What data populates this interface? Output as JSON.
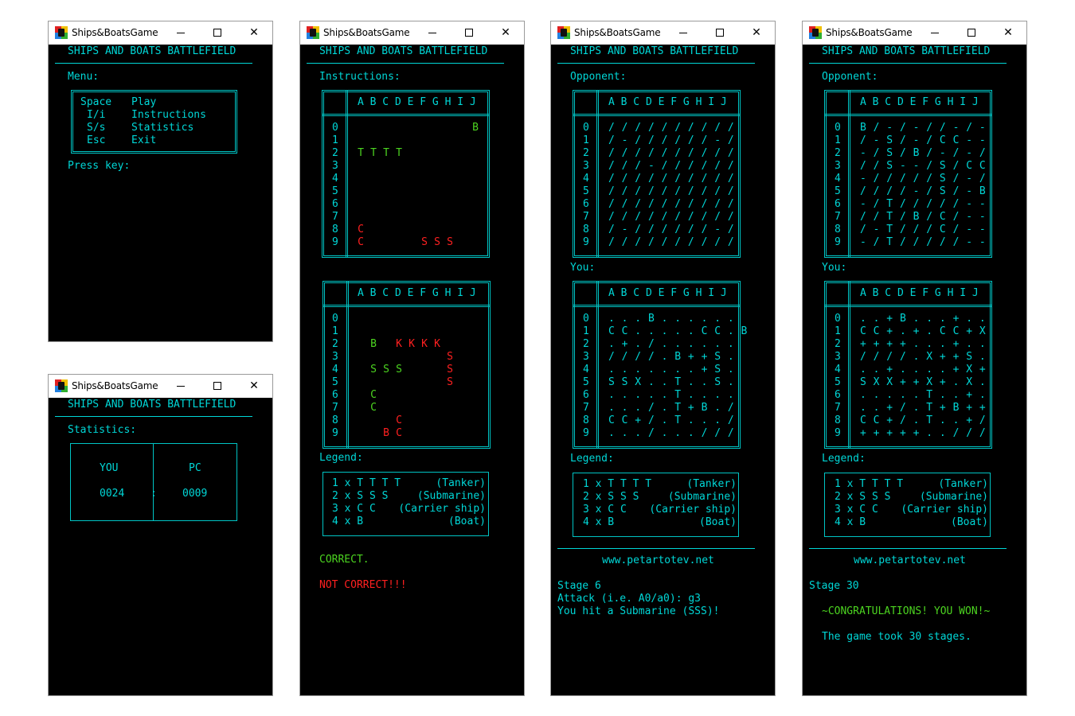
{
  "window_title": "Ships&BoatsGame",
  "banner": "SHIPS AND BOATS BATTLEFIELD",
  "menu_window": {
    "heading": "Menu:",
    "keys": [
      "Space",
      "I/i",
      "S/s",
      "Esc"
    ],
    "labels": [
      "Play",
      "Instructions",
      "Statistics",
      "Exit"
    ],
    "prompt": "Press key:"
  },
  "stats_window": {
    "heading": "Statistics:",
    "you_label": "YOU",
    "pc_label": "PC",
    "you_score": "0024",
    "separator": ":",
    "pc_score": "0009"
  },
  "instructions_window": {
    "heading": "Instructions:",
    "columns": "A B C D E F G H I J",
    "row_numbers": [
      "0",
      "1",
      "2",
      "3",
      "4",
      "5",
      "6",
      "7",
      "8",
      "9"
    ],
    "board1_rows": [
      [
        " ",
        " ",
        " ",
        " ",
        " ",
        " ",
        " ",
        " ",
        " ",
        "B"
      ],
      [
        " ",
        " ",
        " ",
        " ",
        " ",
        " ",
        " ",
        " ",
        " ",
        " "
      ],
      [
        "T",
        "T",
        "T",
        "T",
        " ",
        " ",
        " ",
        " ",
        " ",
        " "
      ],
      [
        " ",
        " ",
        " ",
        " ",
        " ",
        " ",
        " ",
        " ",
        " ",
        " "
      ],
      [
        " ",
        " ",
        " ",
        " ",
        " ",
        " ",
        " ",
        " ",
        " ",
        " "
      ],
      [
        " ",
        " ",
        " ",
        " ",
        " ",
        " ",
        " ",
        " ",
        " ",
        " "
      ],
      [
        " ",
        " ",
        " ",
        " ",
        " ",
        " ",
        " ",
        " ",
        " ",
        " "
      ],
      [
        " ",
        " ",
        " ",
        " ",
        " ",
        " ",
        " ",
        " ",
        " ",
        " "
      ],
      [
        "C",
        " ",
        " ",
        " ",
        " ",
        " ",
        " ",
        " ",
        " ",
        " "
      ],
      [
        "C",
        " ",
        " ",
        " ",
        " ",
        "S",
        "S",
        "S",
        " ",
        " "
      ]
    ],
    "board1_colors": [
      [
        "",
        "",
        "",
        "",
        "",
        "",
        "",
        "",
        "",
        "g"
      ],
      [
        "",
        "",
        "",
        "",
        "",
        "",
        "",
        "",
        "",
        ""
      ],
      [
        "g",
        "g",
        "g",
        "g",
        "",
        "",
        "",
        "",
        "",
        ""
      ],
      [
        "",
        "",
        "",
        "",
        "",
        "",
        "",
        "",
        "",
        ""
      ],
      [
        "",
        "",
        "",
        "",
        "",
        "",
        "",
        "",
        "",
        ""
      ],
      [
        "",
        "",
        "",
        "",
        "",
        "",
        "",
        "",
        "",
        ""
      ],
      [
        "",
        "",
        "",
        "",
        "",
        "",
        "",
        "",
        "",
        ""
      ],
      [
        "",
        "",
        "",
        "",
        "",
        "",
        "",
        "",
        "",
        ""
      ],
      [
        "r",
        "",
        "",
        "",
        "",
        "",
        "",
        "",
        "",
        ""
      ],
      [
        "r",
        "",
        "",
        "",
        "",
        "r",
        "r",
        "r",
        "",
        ""
      ]
    ],
    "board2_rows": [
      [
        " ",
        " ",
        " ",
        " ",
        " ",
        " ",
        " ",
        " ",
        " ",
        " "
      ],
      [
        " ",
        " ",
        " ",
        " ",
        " ",
        " ",
        " ",
        " ",
        " ",
        " "
      ],
      [
        " ",
        "B",
        " ",
        "K",
        "K",
        "K",
        "K",
        " ",
        " ",
        " "
      ],
      [
        " ",
        " ",
        " ",
        " ",
        " ",
        " ",
        " ",
        "S",
        " ",
        " "
      ],
      [
        " ",
        "S",
        "S",
        "S",
        " ",
        " ",
        " ",
        "S",
        " ",
        " "
      ],
      [
        " ",
        " ",
        " ",
        " ",
        " ",
        " ",
        " ",
        "S",
        " ",
        " "
      ],
      [
        " ",
        "C",
        " ",
        " ",
        " ",
        " ",
        " ",
        " ",
        " ",
        " "
      ],
      [
        " ",
        "C",
        " ",
        " ",
        " ",
        " ",
        " ",
        " ",
        " ",
        " "
      ],
      [
        " ",
        " ",
        " ",
        "C",
        " ",
        " ",
        " ",
        " ",
        " ",
        " "
      ],
      [
        " ",
        " ",
        "B",
        "C",
        " ",
        " ",
        " ",
        " ",
        " ",
        " "
      ]
    ],
    "board2_colors": [
      [
        "",
        "",
        "",
        "",
        "",
        "",
        "",
        "",
        "",
        ""
      ],
      [
        "",
        "",
        "",
        "",
        "",
        "",
        "",
        "",
        "",
        ""
      ],
      [
        "",
        "g",
        "",
        "r",
        "r",
        "r",
        "r",
        "",
        "",
        ""
      ],
      [
        "",
        "",
        "",
        "",
        "",
        "",
        "",
        "r",
        "",
        ""
      ],
      [
        "",
        "g",
        "g",
        "g",
        "",
        "",
        "",
        "r",
        "",
        ""
      ],
      [
        "",
        "",
        "",
        "",
        "",
        "",
        "",
        "r",
        "",
        ""
      ],
      [
        "",
        "g",
        "",
        "",
        "",
        "",
        "",
        "",
        "",
        ""
      ],
      [
        "",
        "g",
        "",
        "",
        "",
        "",
        "",
        "",
        "",
        ""
      ],
      [
        "",
        "",
        "",
        "r",
        "",
        "",
        "",
        "",
        "",
        ""
      ],
      [
        "",
        "",
        "r",
        "r",
        "",
        "",
        "",
        "",
        "",
        ""
      ]
    ],
    "legend_heading": "Legend:",
    "legend": [
      {
        "left": "1 x T T T T",
        "right": "(Tanker)"
      },
      {
        "left": "2 x S S S",
        "right": "(Submarine)"
      },
      {
        "left": "3 x C C",
        "right": "(Carrier ship)"
      },
      {
        "left": "4 x B",
        "right": "(Boat)"
      }
    ],
    "correct": "CORRECT.",
    "not_correct": "NOT CORRECT!!!"
  },
  "game_window": {
    "opponent_heading": "Opponent:",
    "you_heading": "You:",
    "columns": "A B C D E F G H I J",
    "row_numbers": [
      "0",
      "1",
      "2",
      "3",
      "4",
      "5",
      "6",
      "7",
      "8",
      "9"
    ],
    "opponent_rows": [
      "/ / / / / / / / / /",
      "/ - / / / / / / - /",
      "/ / / / / / / / / /",
      "/ / / - / / / / / /",
      "/ / / / / / / / / /",
      "/ / / / / / / / / /",
      "/ / / / / / / / / /",
      "/ / / / / / / / / /",
      "/ - / / / / / / - /",
      "/ / / / / / / / / /"
    ],
    "you_rows": [
      ". . . B . . . . . .",
      "C C . . . . . C C . B",
      ". + . / . . . . . .",
      "/ / / / . B + + S .",
      ". . . . . . . + S .",
      "S S X . . T . . S .",
      ". . . . . T . . . .",
      ". . . / . T + B . /",
      "C C + / . T . . . /",
      ". . . / . . . / / /"
    ],
    "legend_heading": "Legend:",
    "legend": [
      {
        "left": "1 x T T T T",
        "right": "(Tanker)"
      },
      {
        "left": "2 x S S S",
        "right": "(Submarine)"
      },
      {
        "left": "3 x C C",
        "right": "(Carrier ship)"
      },
      {
        "left": "4 x B",
        "right": "(Boat)"
      }
    ],
    "website": "www.petartotev.net",
    "stage": "Stage 6",
    "attack": "Attack (i.e. A0/a0): g3",
    "result": "You hit a Submarine (SSS)!"
  },
  "end_window": {
    "opponent_heading": "Opponent:",
    "you_heading": "You:",
    "columns": "A B C D E F G H I J",
    "row_numbers": [
      "0",
      "1",
      "2",
      "3",
      "4",
      "5",
      "6",
      "7",
      "8",
      "9"
    ],
    "opponent_rows": [
      "B / - / - / / - / -",
      "/ - S / - / C C - -",
      "- / S / B / - / - /",
      "/ / S - - / S / C C",
      "- / / / / / S / - /",
      "/ / / / - / S / - B",
      "- / T / / / / / - -",
      "/ / T / B / C / - -",
      "/ - T / / / C / - -",
      "- / T / / / / / - -"
    ],
    "you_rows": [
      ". . + B . . . + . .",
      "C C + . + . C C + X",
      "+ + + + . . . + . .",
      "/ / / / . X + + S .",
      ". . + . . . . + X +",
      "S X X + + X + . X .",
      ". . . . . T . . + .",
      ". . + / . T + B + +",
      "C C + / . T . . + /",
      "+ + + + + . . / / /"
    ],
    "legend_heading": "Legend:",
    "legend": [
      {
        "left": "1 x T T T T",
        "right": "(Tanker)"
      },
      {
        "left": "2 x S S S",
        "right": "(Submarine)"
      },
      {
        "left": "3 x C C",
        "right": "(Carrier ship)"
      },
      {
        "left": "4 x B",
        "right": "(Boat)"
      }
    ],
    "website": "www.petartotev.net",
    "stage": "Stage 30",
    "congrats": "~CONGRATULATIONS! YOU WON!~",
    "took": "The game took 30 stages."
  },
  "colors": {
    "cyan": "#00d7d7",
    "red": "#ff2020",
    "green": "#4cd420",
    "console_bg": "#000000"
  }
}
